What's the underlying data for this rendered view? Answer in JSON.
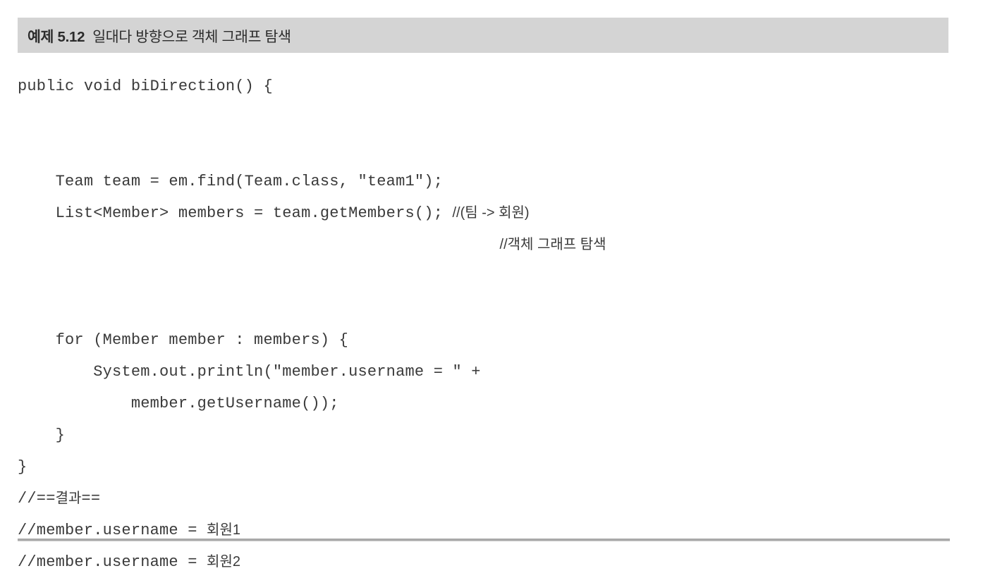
{
  "caption": {
    "number": "예제 5.12",
    "title": "일대다 방향으로 객체 그래프 탐색",
    "bar_color": "#d4d4d4",
    "text_color": "#2b2b2b"
  },
  "code": {
    "language": "java",
    "text_color": "#3a3a3a",
    "lines": [
      {
        "id": "l1",
        "indent": 0,
        "text": "public void biDirection() {"
      },
      {
        "id": "l2",
        "indent": 0,
        "text": ""
      },
      {
        "id": "l3",
        "indent": 0,
        "text": ""
      },
      {
        "id": "l4",
        "indent": 4,
        "text": "Team team = em.find(Team.class, \"team1\");"
      },
      {
        "id": "l5",
        "indent": 4,
        "code": "List<Member> members = team.getMembers(); ",
        "comment": "//(팀 -> 회원)"
      },
      {
        "id": "l6",
        "indent": 0,
        "code": "                                                   ",
        "comment": "//객체 그래프 탐색"
      },
      {
        "id": "l7",
        "indent": 0,
        "text": ""
      },
      {
        "id": "l8",
        "indent": 0,
        "text": ""
      },
      {
        "id": "l9",
        "indent": 4,
        "text": "for (Member member : members) {"
      },
      {
        "id": "l10",
        "indent": 8,
        "text": "System.out.println(\"member.username = \" +"
      },
      {
        "id": "l11",
        "indent": 12,
        "text": "member.getUsername());"
      },
      {
        "id": "l12",
        "indent": 4,
        "text": "}"
      },
      {
        "id": "l13",
        "indent": 0,
        "text": "}"
      },
      {
        "id": "l14",
        "indent": 0,
        "code": "//==",
        "comment": "결과",
        "code_tail": "=="
      },
      {
        "id": "l15",
        "indent": 0,
        "code": "//member.username = ",
        "comment": "회원1"
      },
      {
        "id": "l16",
        "indent": 0,
        "code": "//member.username = ",
        "comment": "회원2"
      }
    ]
  },
  "rule": {
    "color": "#a9a9a9"
  }
}
